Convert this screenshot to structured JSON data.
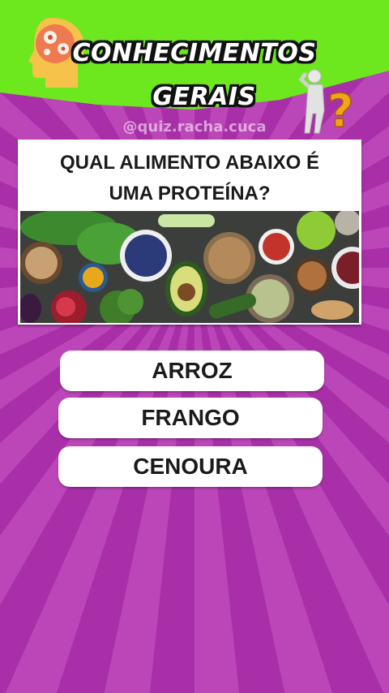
{
  "header": {
    "title_line1": "CONHECIMENTOS",
    "title_line2": "GERAIS",
    "watermark": "@quiz.racha.cuca",
    "colors": {
      "header_green": "#6ee81e",
      "background_purple": "#b43fb0"
    }
  },
  "icons": {
    "left": "brain-head-gears-icon",
    "right": "thinking-figure-question-mark-icon"
  },
  "question": {
    "line1": "QUAL ALIMENTO ABAIXO É",
    "line2": "UMA PROTEÍNA?",
    "image": "assorted-healthy-foods-photo"
  },
  "answers": [
    {
      "label": "ARROZ"
    },
    {
      "label": "FRANGO"
    },
    {
      "label": "CENOURA"
    }
  ]
}
